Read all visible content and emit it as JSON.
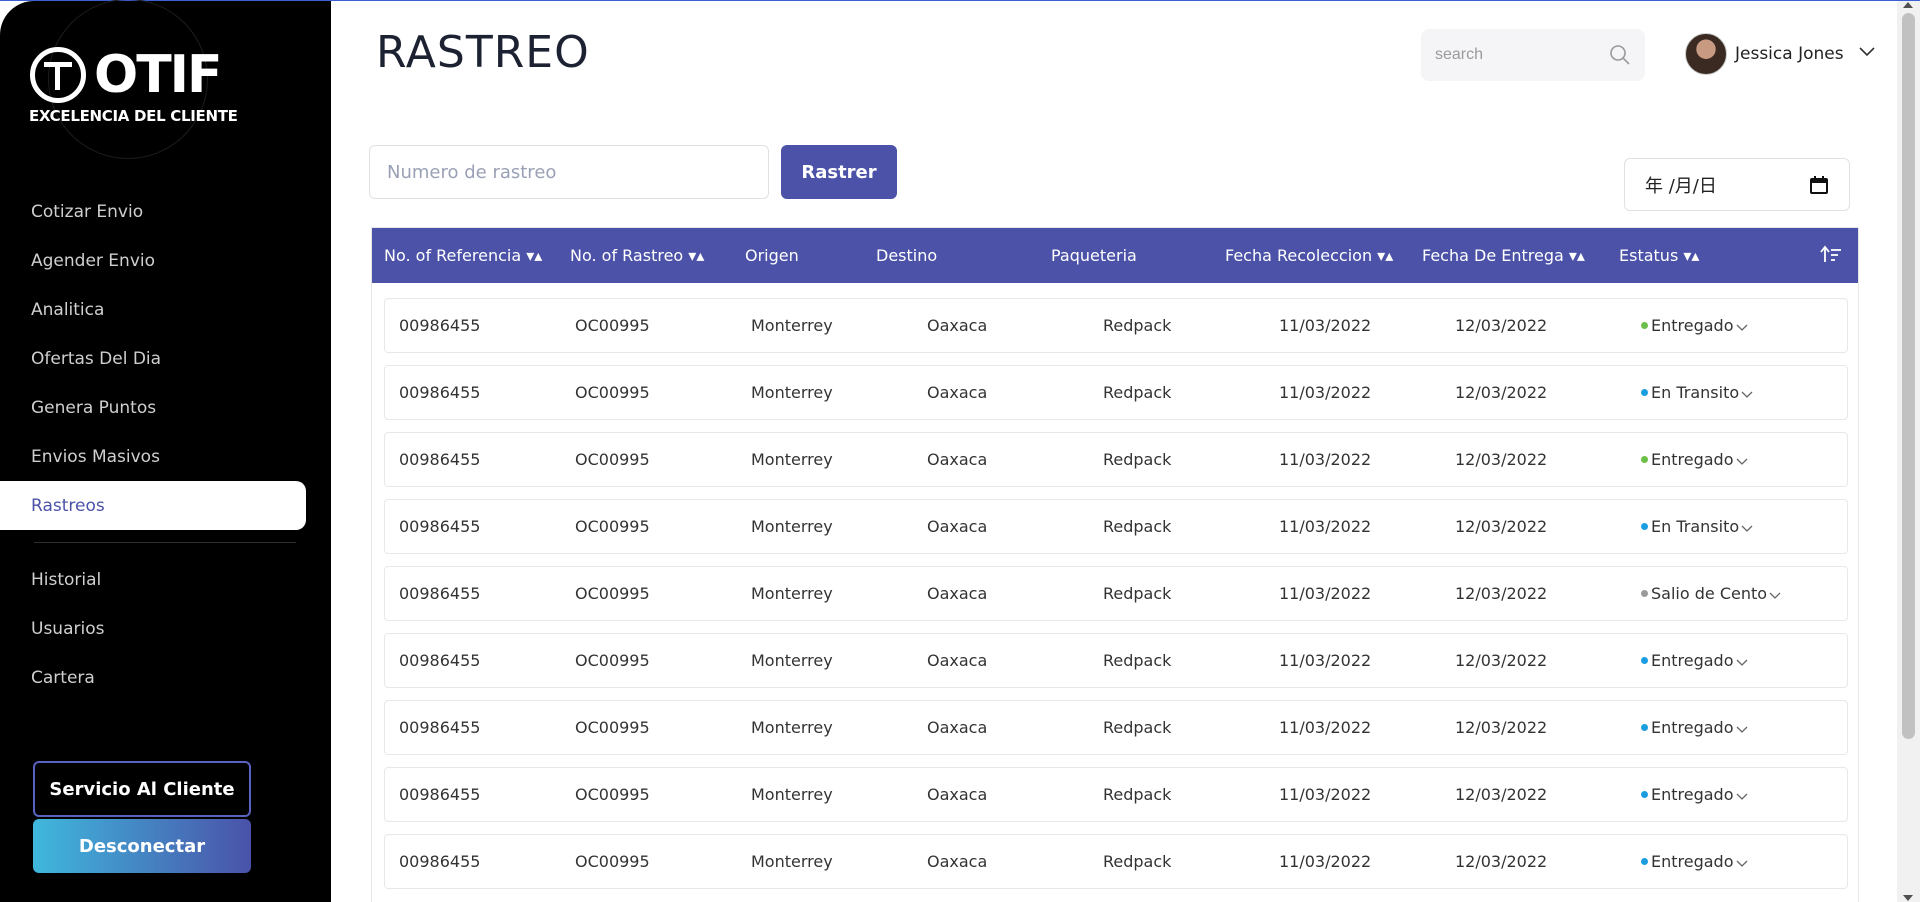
{
  "brand": {
    "name": "OTIF",
    "tagline": "EXCELENCIA DEL CLIENTE"
  },
  "sidebar": {
    "items": [
      {
        "label": "Cotizar Envio",
        "active": false
      },
      {
        "label": "Agender Envio",
        "active": false
      },
      {
        "label": "Analitica",
        "active": false
      },
      {
        "label": "Ofertas Del Dia",
        "active": false
      },
      {
        "label": "Genera Puntos",
        "active": false
      },
      {
        "label": "Envios Masivos",
        "active": false
      },
      {
        "label": "Rastreos",
        "active": true
      }
    ],
    "secondary_items": [
      {
        "label": "Historial"
      },
      {
        "label": "Usuarios"
      },
      {
        "label": "Cartera"
      }
    ],
    "service_button": "Servicio Al Cliente",
    "logout_button": "Desconectar"
  },
  "header": {
    "title": "RASTREO",
    "search_placeholder": "search",
    "user_name": "Jessica Jones"
  },
  "tracking": {
    "input_placeholder": "Numero de rastreo",
    "button_label": "Rastrer",
    "date_placeholder": "年 /月/日"
  },
  "table": {
    "columns": [
      "No. of Referencia ▾▴",
      "No. of Rastreo ▾▴",
      "Origen",
      "Destino",
      "Paqueteria",
      "Fecha Recoleccion ▾▴",
      "Fecha De Entrega ▾▴",
      "Estatus ▾▴"
    ],
    "rows": [
      {
        "ref": "00986455",
        "tracking": "OC00995",
        "origin": "Monterrey",
        "dest": "Oaxaca",
        "carrier": "Redpack",
        "pickup": "11/03/2022",
        "delivery": "12/03/2022",
        "status": "Entregado",
        "status_color": "#6cc04a"
      },
      {
        "ref": "00986455",
        "tracking": "OC00995",
        "origin": "Monterrey",
        "dest": "Oaxaca",
        "carrier": "Redpack",
        "pickup": "11/03/2022",
        "delivery": "12/03/2022",
        "status": "En Transito",
        "status_color": "#1a9ee0"
      },
      {
        "ref": "00986455",
        "tracking": "OC00995",
        "origin": "Monterrey",
        "dest": "Oaxaca",
        "carrier": "Redpack",
        "pickup": "11/03/2022",
        "delivery": "12/03/2022",
        "status": "Entregado",
        "status_color": "#6cc04a"
      },
      {
        "ref": "00986455",
        "tracking": "OC00995",
        "origin": "Monterrey",
        "dest": "Oaxaca",
        "carrier": "Redpack",
        "pickup": "11/03/2022",
        "delivery": "12/03/2022",
        "status": "En Transito",
        "status_color": "#1a9ee0"
      },
      {
        "ref": "00986455",
        "tracking": "OC00995",
        "origin": "Monterrey",
        "dest": "Oaxaca",
        "carrier": "Redpack",
        "pickup": "11/03/2022",
        "delivery": "12/03/2022",
        "status": "Salio de Cento",
        "status_color": "#9a9a9a"
      },
      {
        "ref": "00986455",
        "tracking": "OC00995",
        "origin": "Monterrey",
        "dest": "Oaxaca",
        "carrier": "Redpack",
        "pickup": "11/03/2022",
        "delivery": "12/03/2022",
        "status": "Entregado",
        "status_color": "#1a9ee0"
      },
      {
        "ref": "00986455",
        "tracking": "OC00995",
        "origin": "Monterrey",
        "dest": "Oaxaca",
        "carrier": "Redpack",
        "pickup": "11/03/2022",
        "delivery": "12/03/2022",
        "status": "Entregado",
        "status_color": "#1a9ee0"
      },
      {
        "ref": "00986455",
        "tracking": "OC00995",
        "origin": "Monterrey",
        "dest": "Oaxaca",
        "carrier": "Redpack",
        "pickup": "11/03/2022",
        "delivery": "12/03/2022",
        "status": "Entregado",
        "status_color": "#1a9ee0"
      },
      {
        "ref": "00986455",
        "tracking": "OC00995",
        "origin": "Monterrey",
        "dest": "Oaxaca",
        "carrier": "Redpack",
        "pickup": "11/03/2022",
        "delivery": "12/03/2022",
        "status": "Entregado",
        "status_color": "#1a9ee0"
      }
    ]
  },
  "colors": {
    "accent": "#4b52a8",
    "sidebar_bg": "#000000",
    "gradient_start": "#3fb8dd"
  },
  "icons": {
    "search": "search-icon",
    "chevron": "chevron-down-icon",
    "sort": "sort-icon",
    "calendar": "calendar-icon"
  }
}
